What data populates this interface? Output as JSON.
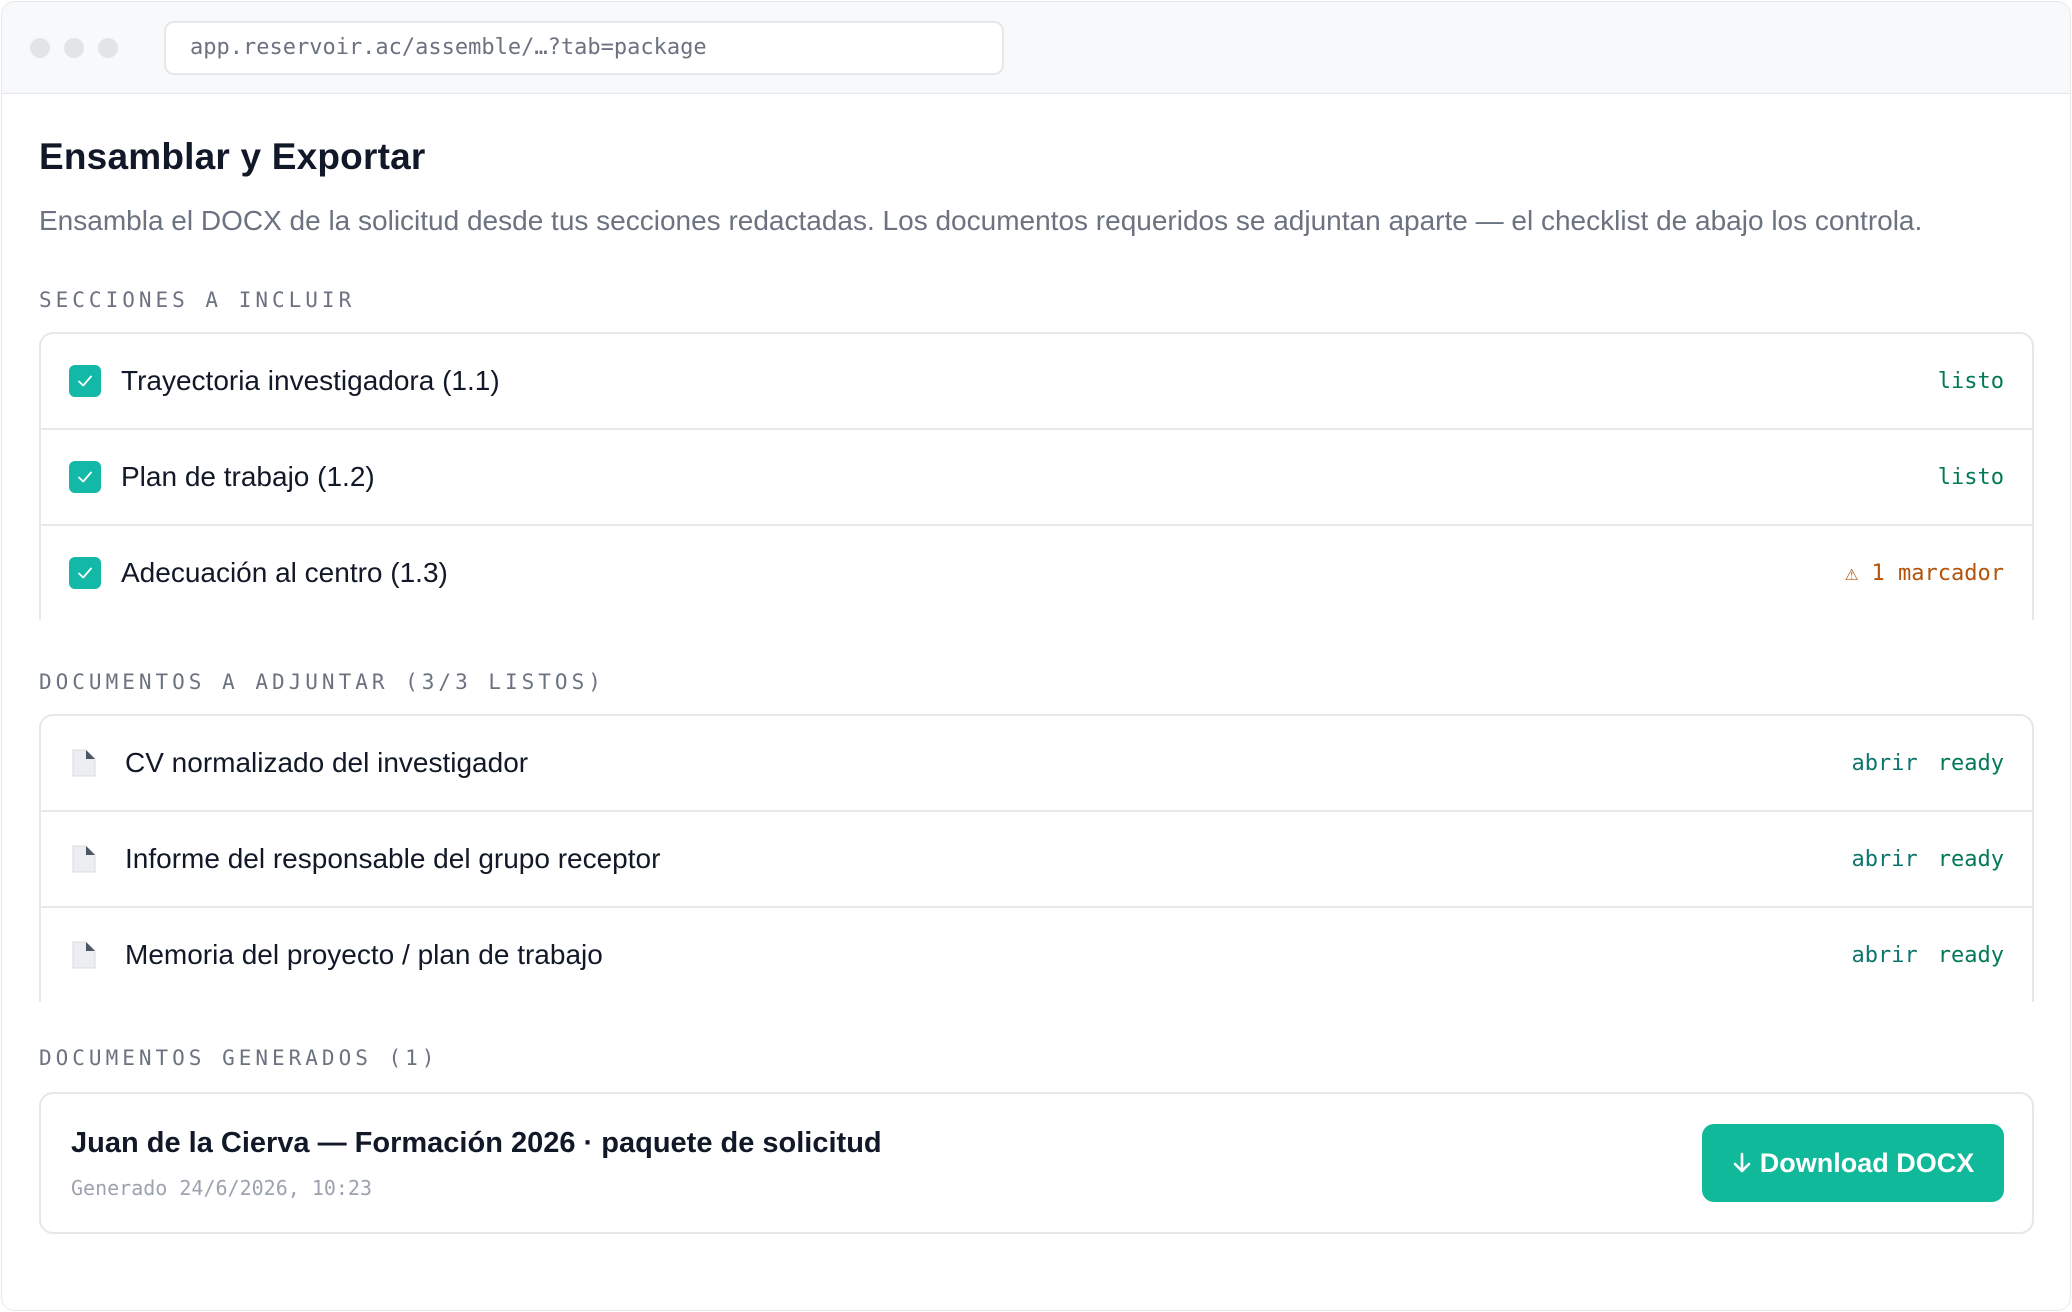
{
  "browser": {
    "url": "app.reservoir.ac/assemble/…?tab=package"
  },
  "page": {
    "title": "Ensamblar y Exportar",
    "subtitle": "Ensambla el DOCX de la solicitud desde tus secciones redactadas. Los documentos requeridos se adjuntan aparte — el checklist de abajo los controla."
  },
  "sections": {
    "label": "SECCIONES A INCLUIR",
    "items": [
      {
        "label": "Trayectoria investigadora (1.1)",
        "checked": true,
        "status": "listo"
      },
      {
        "label": "Plan de trabajo (1.2)",
        "checked": true,
        "status": "listo"
      },
      {
        "label": "Adecuación al centro (1.3)",
        "checked": true,
        "status": "⚠ 1 marcador"
      }
    ]
  },
  "attachments": {
    "label": "DOCUMENTOS A ADJUNTAR (3/3 LISTOS)",
    "items": [
      {
        "label": "CV normalizado del investigador",
        "action": "abrir",
        "status": "ready"
      },
      {
        "label": "Informe del responsable del grupo receptor",
        "action": "abrir",
        "status": "ready"
      },
      {
        "label": "Memoria del proyecto / plan de trabajo",
        "action": "abrir",
        "status": "ready"
      }
    ]
  },
  "generated": {
    "label": "DOCUMENTOS GENERADOS (1)",
    "items": [
      {
        "title": "Juan de la Cierva — Formación 2026 · paquete de solicitud",
        "meta": "Generado 24/6/2026, 10:23",
        "button": "Download DOCX"
      }
    ]
  },
  "colors": {
    "accent": "#10b99a",
    "ok": "#047857",
    "warn": "#b45309"
  }
}
